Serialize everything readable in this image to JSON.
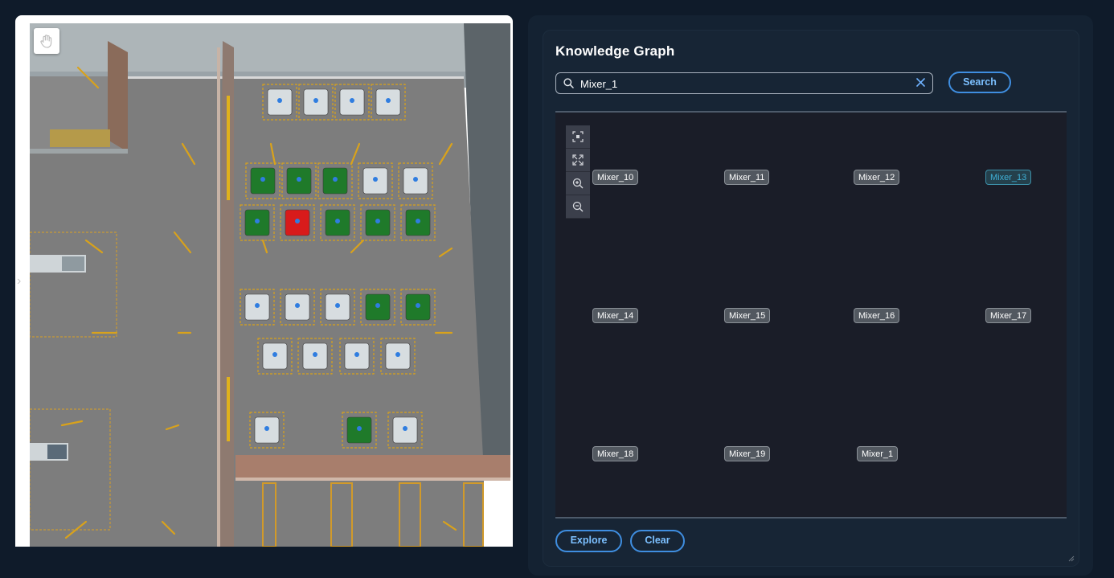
{
  "viewport": {
    "scene_name": "factory-floor-3d-view",
    "hand_tool_icon": "hand-pan-icon",
    "expand_icon": "chevron-right-icon"
  },
  "knowledge_graph": {
    "title": "Knowledge Graph",
    "search": {
      "value": "Mixer_1",
      "search_icon": "search-icon",
      "clear_icon": "close-icon",
      "button_label": "Search"
    },
    "tools": [
      "fit-view-icon",
      "expand-icon",
      "zoom-in-icon",
      "zoom-out-icon"
    ],
    "nodes": [
      {
        "label": "Mixer_10",
        "selected": false
      },
      {
        "label": "Mixer_11",
        "selected": false
      },
      {
        "label": "Mixer_12",
        "selected": false
      },
      {
        "label": "Mixer_13",
        "selected": true
      },
      {
        "label": "Mixer_14",
        "selected": false
      },
      {
        "label": "Mixer_15",
        "selected": false
      },
      {
        "label": "Mixer_16",
        "selected": false
      },
      {
        "label": "Mixer_17",
        "selected": false
      },
      {
        "label": "Mixer_18",
        "selected": false
      },
      {
        "label": "Mixer_19",
        "selected": false
      },
      {
        "label": "Mixer_1",
        "selected": false
      }
    ],
    "explore_label": "Explore",
    "clear_label": "Clear"
  },
  "colors": {
    "page_bg": "#0f1b2a",
    "panel_bg": "#142232",
    "accent": "#3f8ee0",
    "selected_node": "#3fb0d6",
    "machine_green": "#1f7a2a",
    "machine_red": "#d81b1b",
    "machine_white": "#d7dde0",
    "floor": "#7a7a7a",
    "marker": "#d9a21b"
  }
}
